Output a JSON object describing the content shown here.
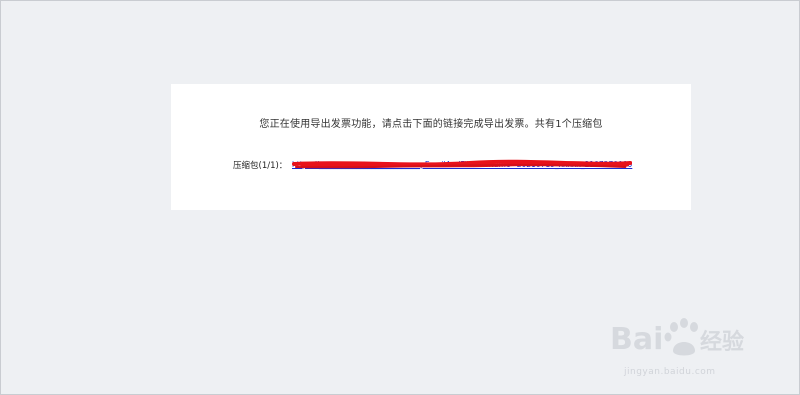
{
  "page": {
    "message": "您正在使用导出发票功能，请点击下面的链接完成导出发票。共有1个压缩包",
    "package_label": "压缩包(1/1)：",
    "package_link_text": "https://___________________________pEmailAndFile?fileName=20210719_xxxxx_2107270000"
  },
  "watermark": {
    "brand": "Baidu经验",
    "url": "jingyan.baidu.com"
  },
  "colors": {
    "background": "#eef0f3",
    "card": "#ffffff",
    "link": "#1a2bd1",
    "redaction": "#e8121b"
  }
}
